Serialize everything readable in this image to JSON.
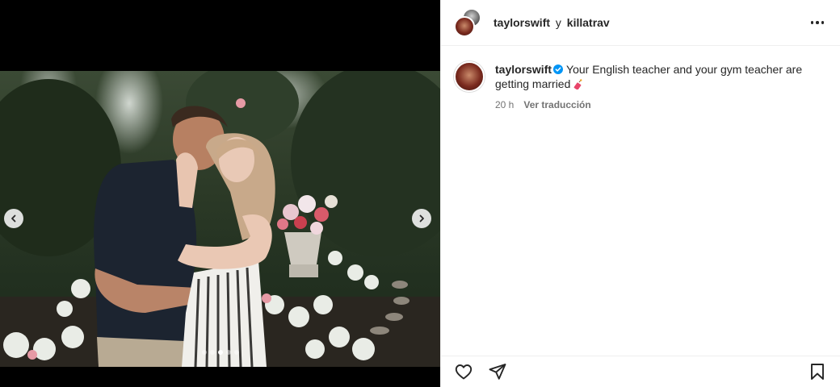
{
  "post": {
    "media": {
      "carousel_total": 5,
      "carousel_active_index": 2,
      "prev_icon": "chevron-left-icon",
      "next_icon": "chevron-right-icon"
    },
    "header": {
      "username_primary": "taylorswift",
      "joiner": "y",
      "username_secondary": "killatrav",
      "more_icon": "more-horizontal-icon"
    },
    "caption": {
      "username": "taylorswift",
      "verified_icon": "verified-badge-icon",
      "text": "Your English teacher and your gym teacher are getting married",
      "emoji_icon": "dynamite-emoji-icon",
      "time": "20 h",
      "translate_label": "Ver traducción"
    },
    "actions": {
      "like_icon": "heart-icon",
      "share_icon": "paper-plane-icon",
      "save_icon": "bookmark-icon"
    },
    "colors": {
      "text": "#262626",
      "muted": "#737373",
      "verified": "#0095f6",
      "divider": "#efefef"
    }
  }
}
